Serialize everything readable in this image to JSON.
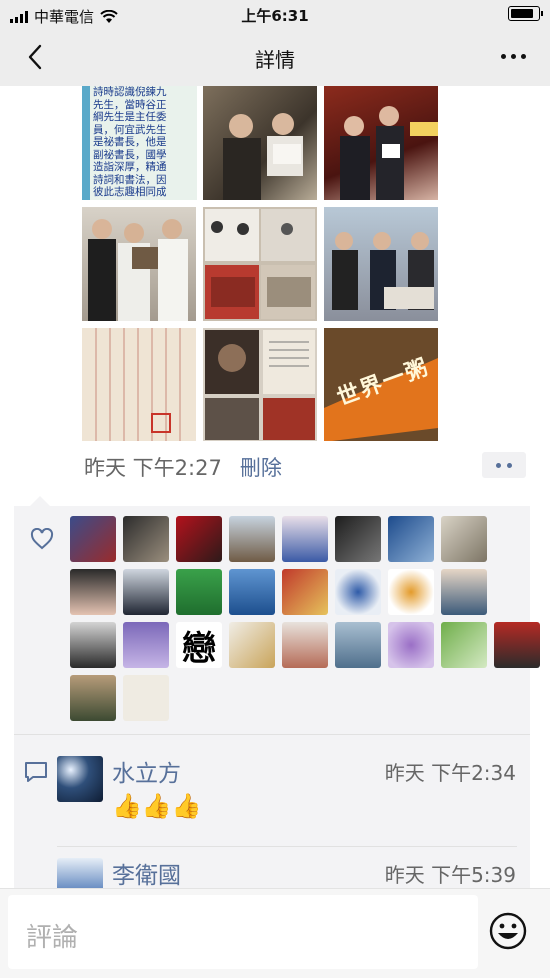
{
  "status_bar": {
    "carrier": "中華電信",
    "time": "上午6:31"
  },
  "nav": {
    "title": "詳情"
  },
  "post": {
    "caption_strip_text": [
      "詩時認識倪鍊九",
      "先生，當時谷正",
      "綱先生是主任委",
      "員，何宜武先生",
      "是祕書長，他是",
      "副祕書長，國學",
      "造詣深厚，精通",
      "詩詞和書法，因",
      "彼此志趣相同成"
    ],
    "sign_text": "世界一粥",
    "meta_time": "昨天 下午2:27",
    "delete_label": "刪除"
  },
  "likes": {
    "count": 29,
    "calligraphy_avatar_text": "戀"
  },
  "comments": [
    {
      "name": "水立方",
      "time": "昨天 下午2:34",
      "text": "👍👍👍"
    },
    {
      "name": "李衛國",
      "time": "昨天 下午5:39",
      "text": ""
    }
  ],
  "input": {
    "placeholder": "評論"
  },
  "colors": {
    "link": "#57709a",
    "nav_bg": "#ededed",
    "comment_bg": "#f3f3f5"
  }
}
